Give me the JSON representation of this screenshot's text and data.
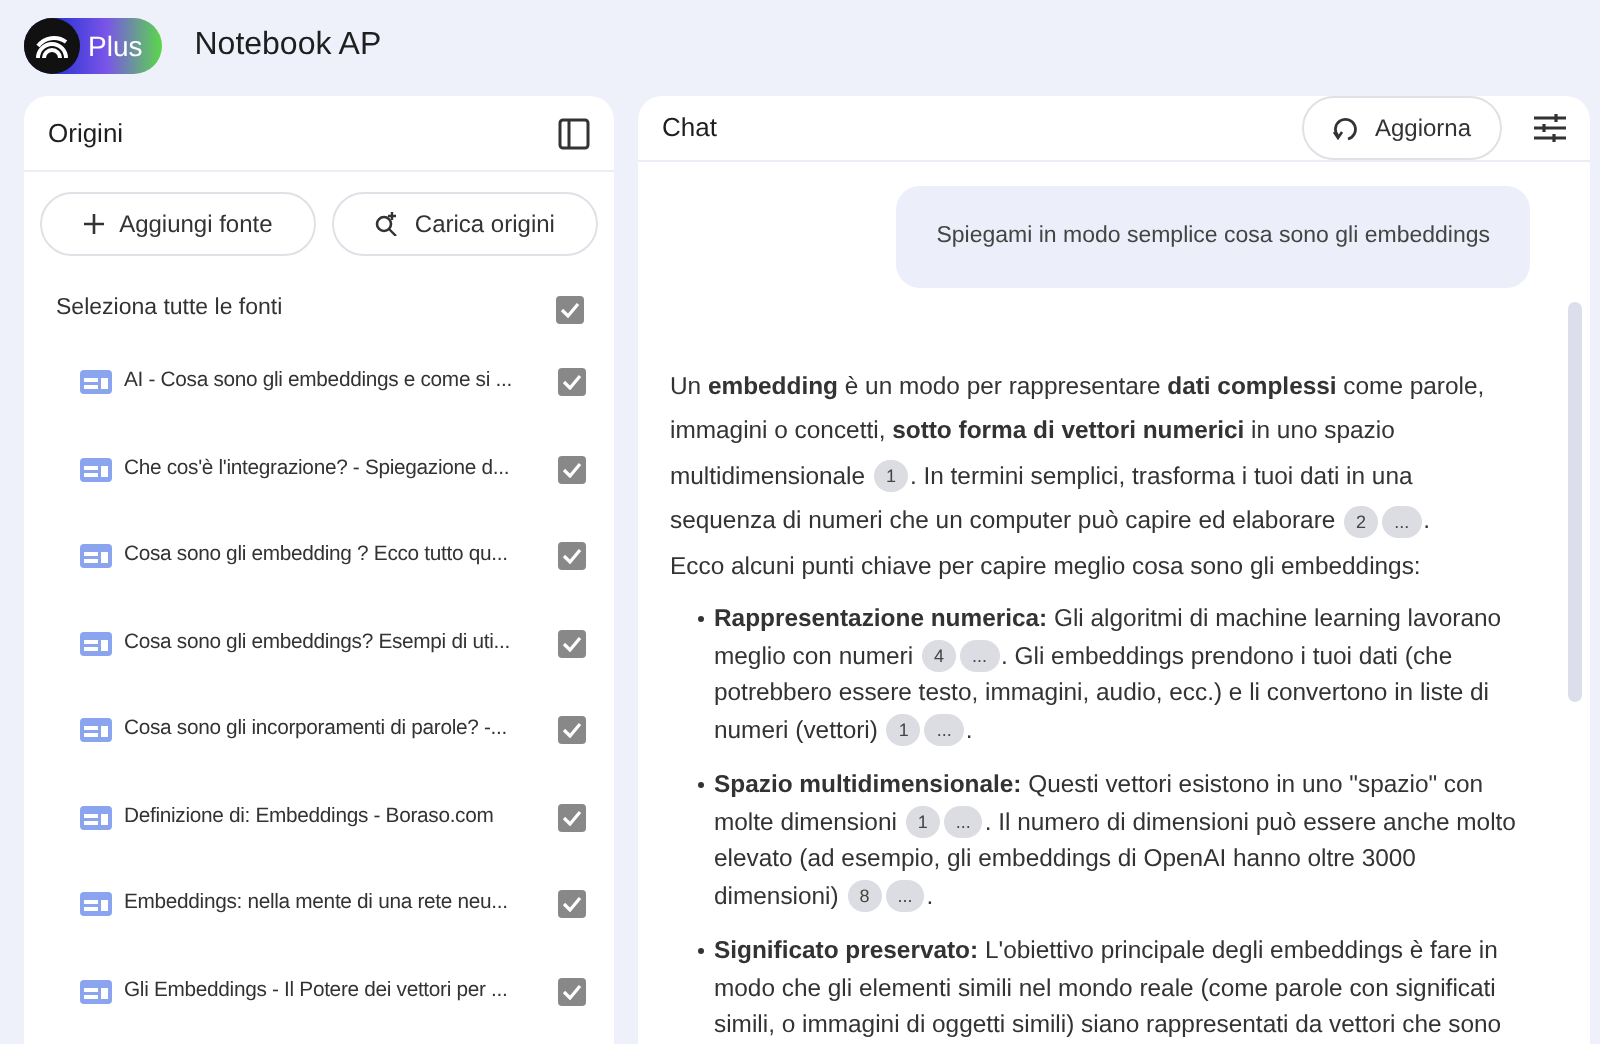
{
  "app": {
    "badge": "Plus",
    "title": "Notebook AP"
  },
  "sources_panel": {
    "title": "Origini",
    "buttons": [
      {
        "kind": "add",
        "label": "Aggiungi fonte"
      },
      {
        "kind": "discover",
        "label": "Carica origini"
      }
    ],
    "select_all": {
      "label": "Seleziona tutte le fonti",
      "checked": true
    },
    "items": [
      {
        "title": "AI - Cosa sono gli embeddings e come si ...",
        "checked": true
      },
      {
        "title": "Che cos'è l'integrazione? - Spiegazione d...",
        "checked": true
      },
      {
        "title": "Cosa sono gli embedding ? Ecco tutto qu...",
        "checked": true
      },
      {
        "title": "Cosa sono gli embeddings? Esempi di uti...",
        "checked": true
      },
      {
        "title": "Cosa sono gli incorporamenti di parole? -...",
        "checked": true
      },
      {
        "title": "Definizione di: Embeddings - Boraso.com",
        "checked": true
      },
      {
        "title": "Embeddings: nella mente di una rete neu...",
        "checked": true
      },
      {
        "title": "Gli Embeddings - Il Potere dei vettori per ...",
        "checked": true
      }
    ]
  },
  "chat_panel": {
    "title": "Chat",
    "refresh_button": "Aggiorna",
    "user_message": "Spiegami in modo semplice cosa sono gli embeddings",
    "answer": [
      {
        "kind": "paragraph",
        "parts": [
          {
            "kind": "text",
            "text": "Un **embedding** è un modo per rappresentare **dati complessi** come parole, immagini o concetti, **sotto forma di vettori numerici** in uno spazio multidimensionale "
          },
          {
            "kind": "cite",
            "text": "1"
          },
          {
            "kind": "text",
            "text": ". In termini semplici, trasforma i tuoi dati in una sequenza di numeri che un computer può capire ed elaborare "
          },
          {
            "kind": "cite",
            "text": "2"
          },
          {
            "kind": "cite",
            "text": "..."
          },
          {
            "kind": "text",
            "text": "."
          }
        ]
      },
      {
        "kind": "paragraph",
        "parts": [
          {
            "kind": "text",
            "text": "Ecco alcuni punti chiave per capire meglio cosa sono gli embeddings:"
          }
        ]
      },
      {
        "kind": "bullet",
        "parts": [
          {
            "kind": "text",
            "text": "**Rappresentazione numerica:** Gli algoritmi di machine learning lavorano meglio con numeri "
          },
          {
            "kind": "cite",
            "text": "4"
          },
          {
            "kind": "cite",
            "text": "..."
          },
          {
            "kind": "text",
            "text": ". Gli embeddings prendono i tuoi dati (che potrebbero essere testo, immagini, audio, ecc.) e li convertono in liste di numeri (vettori) "
          },
          {
            "kind": "cite",
            "text": "1"
          },
          {
            "kind": "cite",
            "text": "..."
          },
          {
            "kind": "text",
            "text": "."
          }
        ]
      },
      {
        "kind": "bullet",
        "parts": [
          {
            "kind": "text",
            "text": "**Spazio multidimensionale:** Questi vettori esistono in uno \"spazio\" con molte dimensioni "
          },
          {
            "kind": "cite",
            "text": "1"
          },
          {
            "kind": "cite",
            "text": "..."
          },
          {
            "kind": "text",
            "text": ". Il numero di dimensioni può essere anche molto elevato (ad esempio, gli embeddings di OpenAI hanno oltre 3000 dimensioni) "
          },
          {
            "kind": "cite",
            "text": "8"
          },
          {
            "kind": "cite",
            "text": "..."
          },
          {
            "kind": "text",
            "text": "."
          }
        ]
      },
      {
        "kind": "bullet",
        "parts": [
          {
            "kind": "text",
            "text": "**Significato preservato:** L'obiettivo principale degli embeddings è fare in modo che gli elementi simili nel mondo reale (come parole con significati simili, o immagini di oggetti simili) siano rappresentati da vettori che sono"
          }
        ]
      }
    ]
  }
}
